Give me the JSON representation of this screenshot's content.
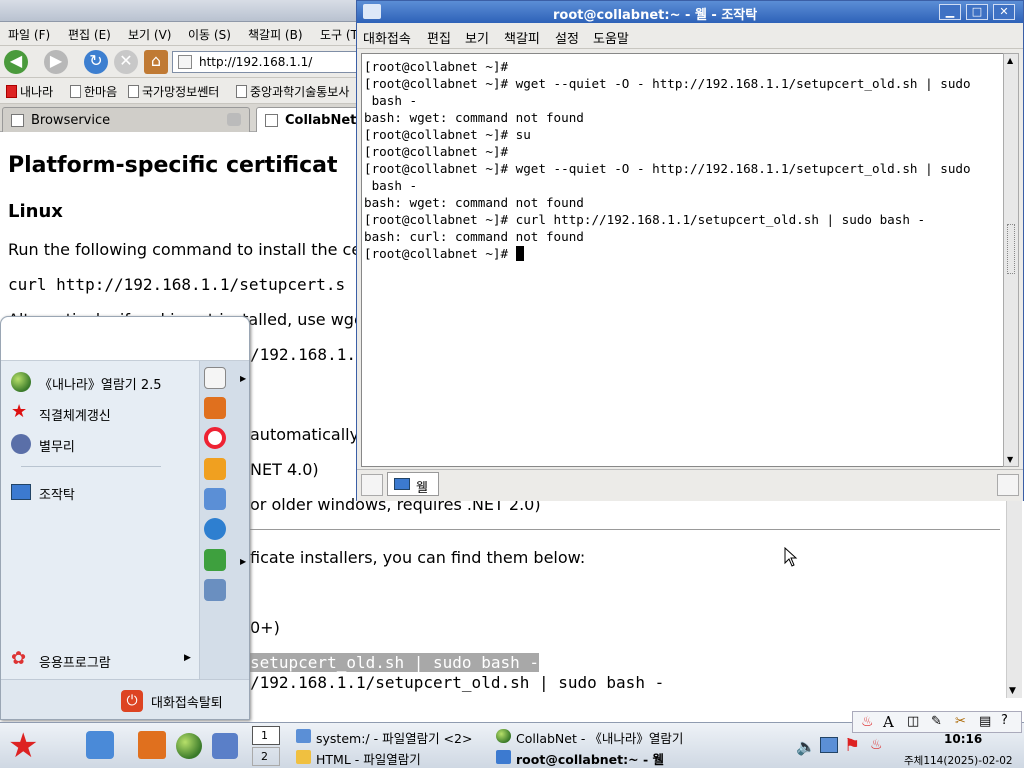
{
  "browser": {
    "menu": [
      "파일 (F)",
      "편집 (E)",
      "보기 (V)",
      "이동 (S)",
      "책갈피 (B)",
      "도구 (T)"
    ],
    "url": "http://192.168.1.1/",
    "bookmarks": [
      "내나라",
      "한마음",
      "국가망정보쎈터",
      "중앙과학기술통보사"
    ],
    "tabs": [
      "Browservice",
      "CollabNet"
    ],
    "content": {
      "heading": "Platform-specific certificat",
      "subheading": "Linux",
      "para1": "Run the following command to install the ce",
      "cmd1": "curl http://192.168.1.1/setupcert.s",
      "para2": "Alternatively, if curl is not installed, use wge",
      "cmd2_frag": "/192.168.1.",
      "auto_frag": "automatically",
      "net4_frag": "NET 4.0)",
      "net2_frag": "or older windows, requires .NET 2.0)",
      "installers_frag": "ficate installers, you can find them below:",
      "ver_frag": "0+)",
      "selected_cmd_frag": "setupcert_old.sh | sudo bash -",
      "cmd3_frag": "/192.168.1.1/setupcert_old.sh | sudo bash -"
    }
  },
  "terminal": {
    "title": "root@collabnet:~ - 웰 - 조작탁",
    "menu": [
      "대화접속",
      "편집",
      "보기",
      "책갈피",
      "설정",
      "도움말"
    ],
    "lines": [
      "[root@collabnet ~]#",
      "[root@collabnet ~]# wget --quiet -O - http://192.168.1.1/setupcert_old.sh | sudo",
      " bash -",
      "bash: wget: command not found",
      "[root@collabnet ~]# su",
      "[root@collabnet ~]#",
      "[root@collabnet ~]# wget --quiet -O - http://192.168.1.1/setupcert_old.sh | sudo",
      " bash -",
      "bash: wget: command not found",
      "[root@collabnet ~]# curl http://192.168.1.1/setupcert_old.sh | sudo bash -",
      "bash: curl: command not found"
    ],
    "prompt": "[root@collabnet ~]# ",
    "tab_label": "웰"
  },
  "startmenu": {
    "items": [
      "《내나라》열람기 2.5",
      "직결체계갱신",
      "별무리",
      "조작탁"
    ],
    "apps_label": "응용프로그람",
    "logout_label": "대화접속탈퇴"
  },
  "taskbar": {
    "desk1": "1",
    "desk2": "2",
    "tasks": [
      "system:/ - 파일열람기 <2>",
      "CollabNet - 《내나라》열람기",
      "HTML - 파일열람기",
      "root@collabnet:~ - 웰"
    ],
    "time": "10:16",
    "date": "주체114(2025)-02-02"
  },
  "colors": {
    "terminal_title": "#2e62b8",
    "selection_bg": "#a8a8a8"
  }
}
